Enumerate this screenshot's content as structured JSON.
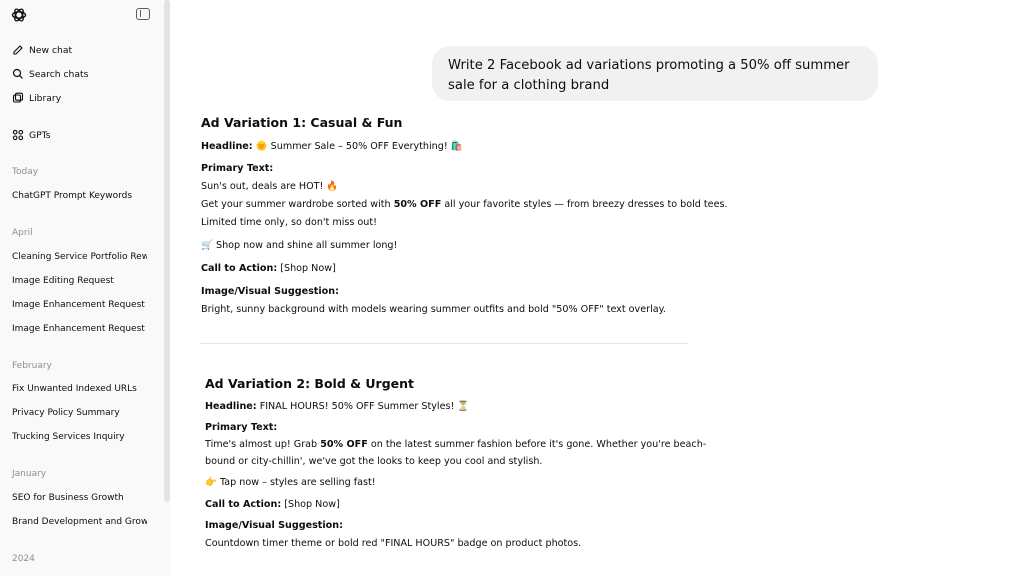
{
  "sidebar": {
    "nav": [
      {
        "label": "New chat",
        "icon": "new-chat-icon"
      },
      {
        "label": "Search chats",
        "icon": "search-icon"
      },
      {
        "label": "Library",
        "icon": "library-icon"
      },
      {
        "label": "GPTs",
        "icon": "gpts-icon"
      }
    ],
    "sections": [
      {
        "title": "Today",
        "items": [
          "ChatGPT Prompt Keywords"
        ]
      },
      {
        "title": "April",
        "items": [
          "Cleaning Service Portfolio Rew...",
          "Image Editing Request",
          "Image Enhancement Request",
          "Image Enhancement Request"
        ]
      },
      {
        "title": "February",
        "items": [
          "Fix Unwanted Indexed URLs",
          "Privacy Policy Summary",
          "Trucking Services Inquiry"
        ]
      },
      {
        "title": "January",
        "items": [
          "SEO for Business Growth",
          "Brand Development and Grow..."
        ]
      },
      {
        "title": "2024",
        "items": []
      }
    ]
  },
  "user_message": "Write 2 Facebook ad variations promoting a 50% off summer sale for a clothing brand",
  "ad1": {
    "title": "Ad Variation 1: Casual & Fun",
    "headline_label": "Headline:",
    "headline_text": " 🌞 Summer Sale – 50% OFF Everything! 🛍️",
    "primary_label": "Primary Text:",
    "line1": "Sun's out, deals are HOT! 🔥",
    "line2_pre": "Get your summer wardrobe sorted with ",
    "line2_bold": "50% OFF",
    "line2_post": " all your favorite styles — from breezy dresses to bold tees.",
    "line3": "Limited time only, so don't miss out!",
    "line4": "🛒 Shop now and shine all summer long!",
    "cta_label": "Call to Action:",
    "cta_text": " [Shop Now]",
    "visual_label": "Image/Visual Suggestion:",
    "visual_text": "Bright, sunny background with models wearing summer outfits and bold \"50% OFF\" text overlay."
  },
  "ad2": {
    "title": "Ad Variation 2: Bold & Urgent",
    "headline_label": "Headline:",
    "headline_text": " FINAL HOURS! 50% OFF Summer Styles! ⏳",
    "primary_label": "Primary Text:",
    "line1_pre": "Time's almost up! Grab ",
    "line1_bold": "50% OFF",
    "line1_post": " on the latest summer fashion before it's gone. Whether you're beach-",
    "line2": "bound or city-chillin', we've got the looks to keep you cool and stylish.",
    "line3": "👉 Tap now – styles are selling fast!",
    "cta_label": "Call to Action:",
    "cta_text": " [Shop Now]",
    "visual_label": "Image/Visual Suggestion:",
    "visual_text": "Countdown timer theme or bold red \"FINAL HOURS\" badge on product photos."
  }
}
